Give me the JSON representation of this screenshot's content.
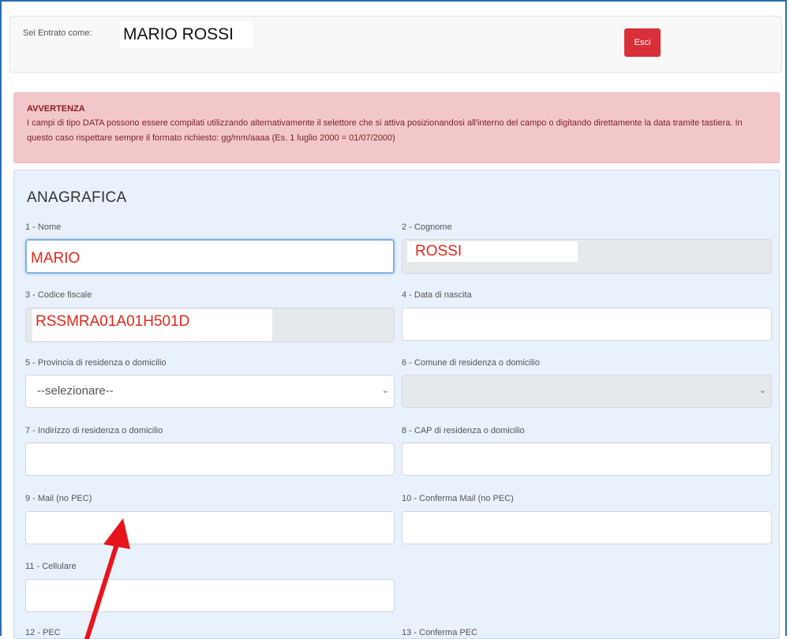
{
  "header": {
    "logged_prefix": "Sei Entrato come:",
    "user_name": "MARIO ROSSI",
    "exit_label": "Esci"
  },
  "alert": {
    "title": "AVVERTENZA",
    "text": "I campi di tipo DATA possono essere compilati utilizzando alternativamente il selettore che si attiva posizionandosi all'interno del campo o digitando direttamente la data tramite tastiera. In questo caso rispettare sempre il formato richiesto: gg/mm/aaaa (Es. 1 luglio 2000 = 01/07/2000)"
  },
  "form": {
    "section_title": "ANAGRAFICA",
    "nome": {
      "label": "1 - Nome",
      "value": "MARIO"
    },
    "cognome": {
      "label": "2 - Cognome",
      "value": "ROSSI"
    },
    "codice_fiscale": {
      "label": "3 - Codice fiscale",
      "value": "RSSMRA01A01H501D"
    },
    "data_nascita": {
      "label": "4 - Data di nascita",
      "value": ""
    },
    "provincia": {
      "label": "5 - Provincia di residenza o domicilio",
      "selected": "--selezionare--"
    },
    "comune": {
      "label": "6 - Comune di residenza o domicilio",
      "selected": ""
    },
    "indirizzo": {
      "label": "7 - Indirizzo di residenza o domicilio",
      "value": ""
    },
    "cap": {
      "label": "8 - CAP di residenza o domicilio",
      "value": ""
    },
    "mail": {
      "label": "9 - Mail (no PEC)",
      "value": ""
    },
    "conferma_mail": {
      "label": "10 - Conferma Mail (no PEC)",
      "value": ""
    },
    "cellulare": {
      "label": "11 - Cellulare",
      "value": ""
    },
    "pec": {
      "label": "12 - PEC"
    },
    "conferma_pec": {
      "label": "13 - Conferma PEC"
    }
  },
  "colors": {
    "exit_button": "#d9303a",
    "alert_bg": "#f2c7c9",
    "panel_bg": "#e8f1fc",
    "annotation_arrow": "#e8141c",
    "redacted_value_text": "#e2271a"
  },
  "icons": {
    "select_caret": "chevron-down-icon",
    "annotation": "red-arrow"
  }
}
